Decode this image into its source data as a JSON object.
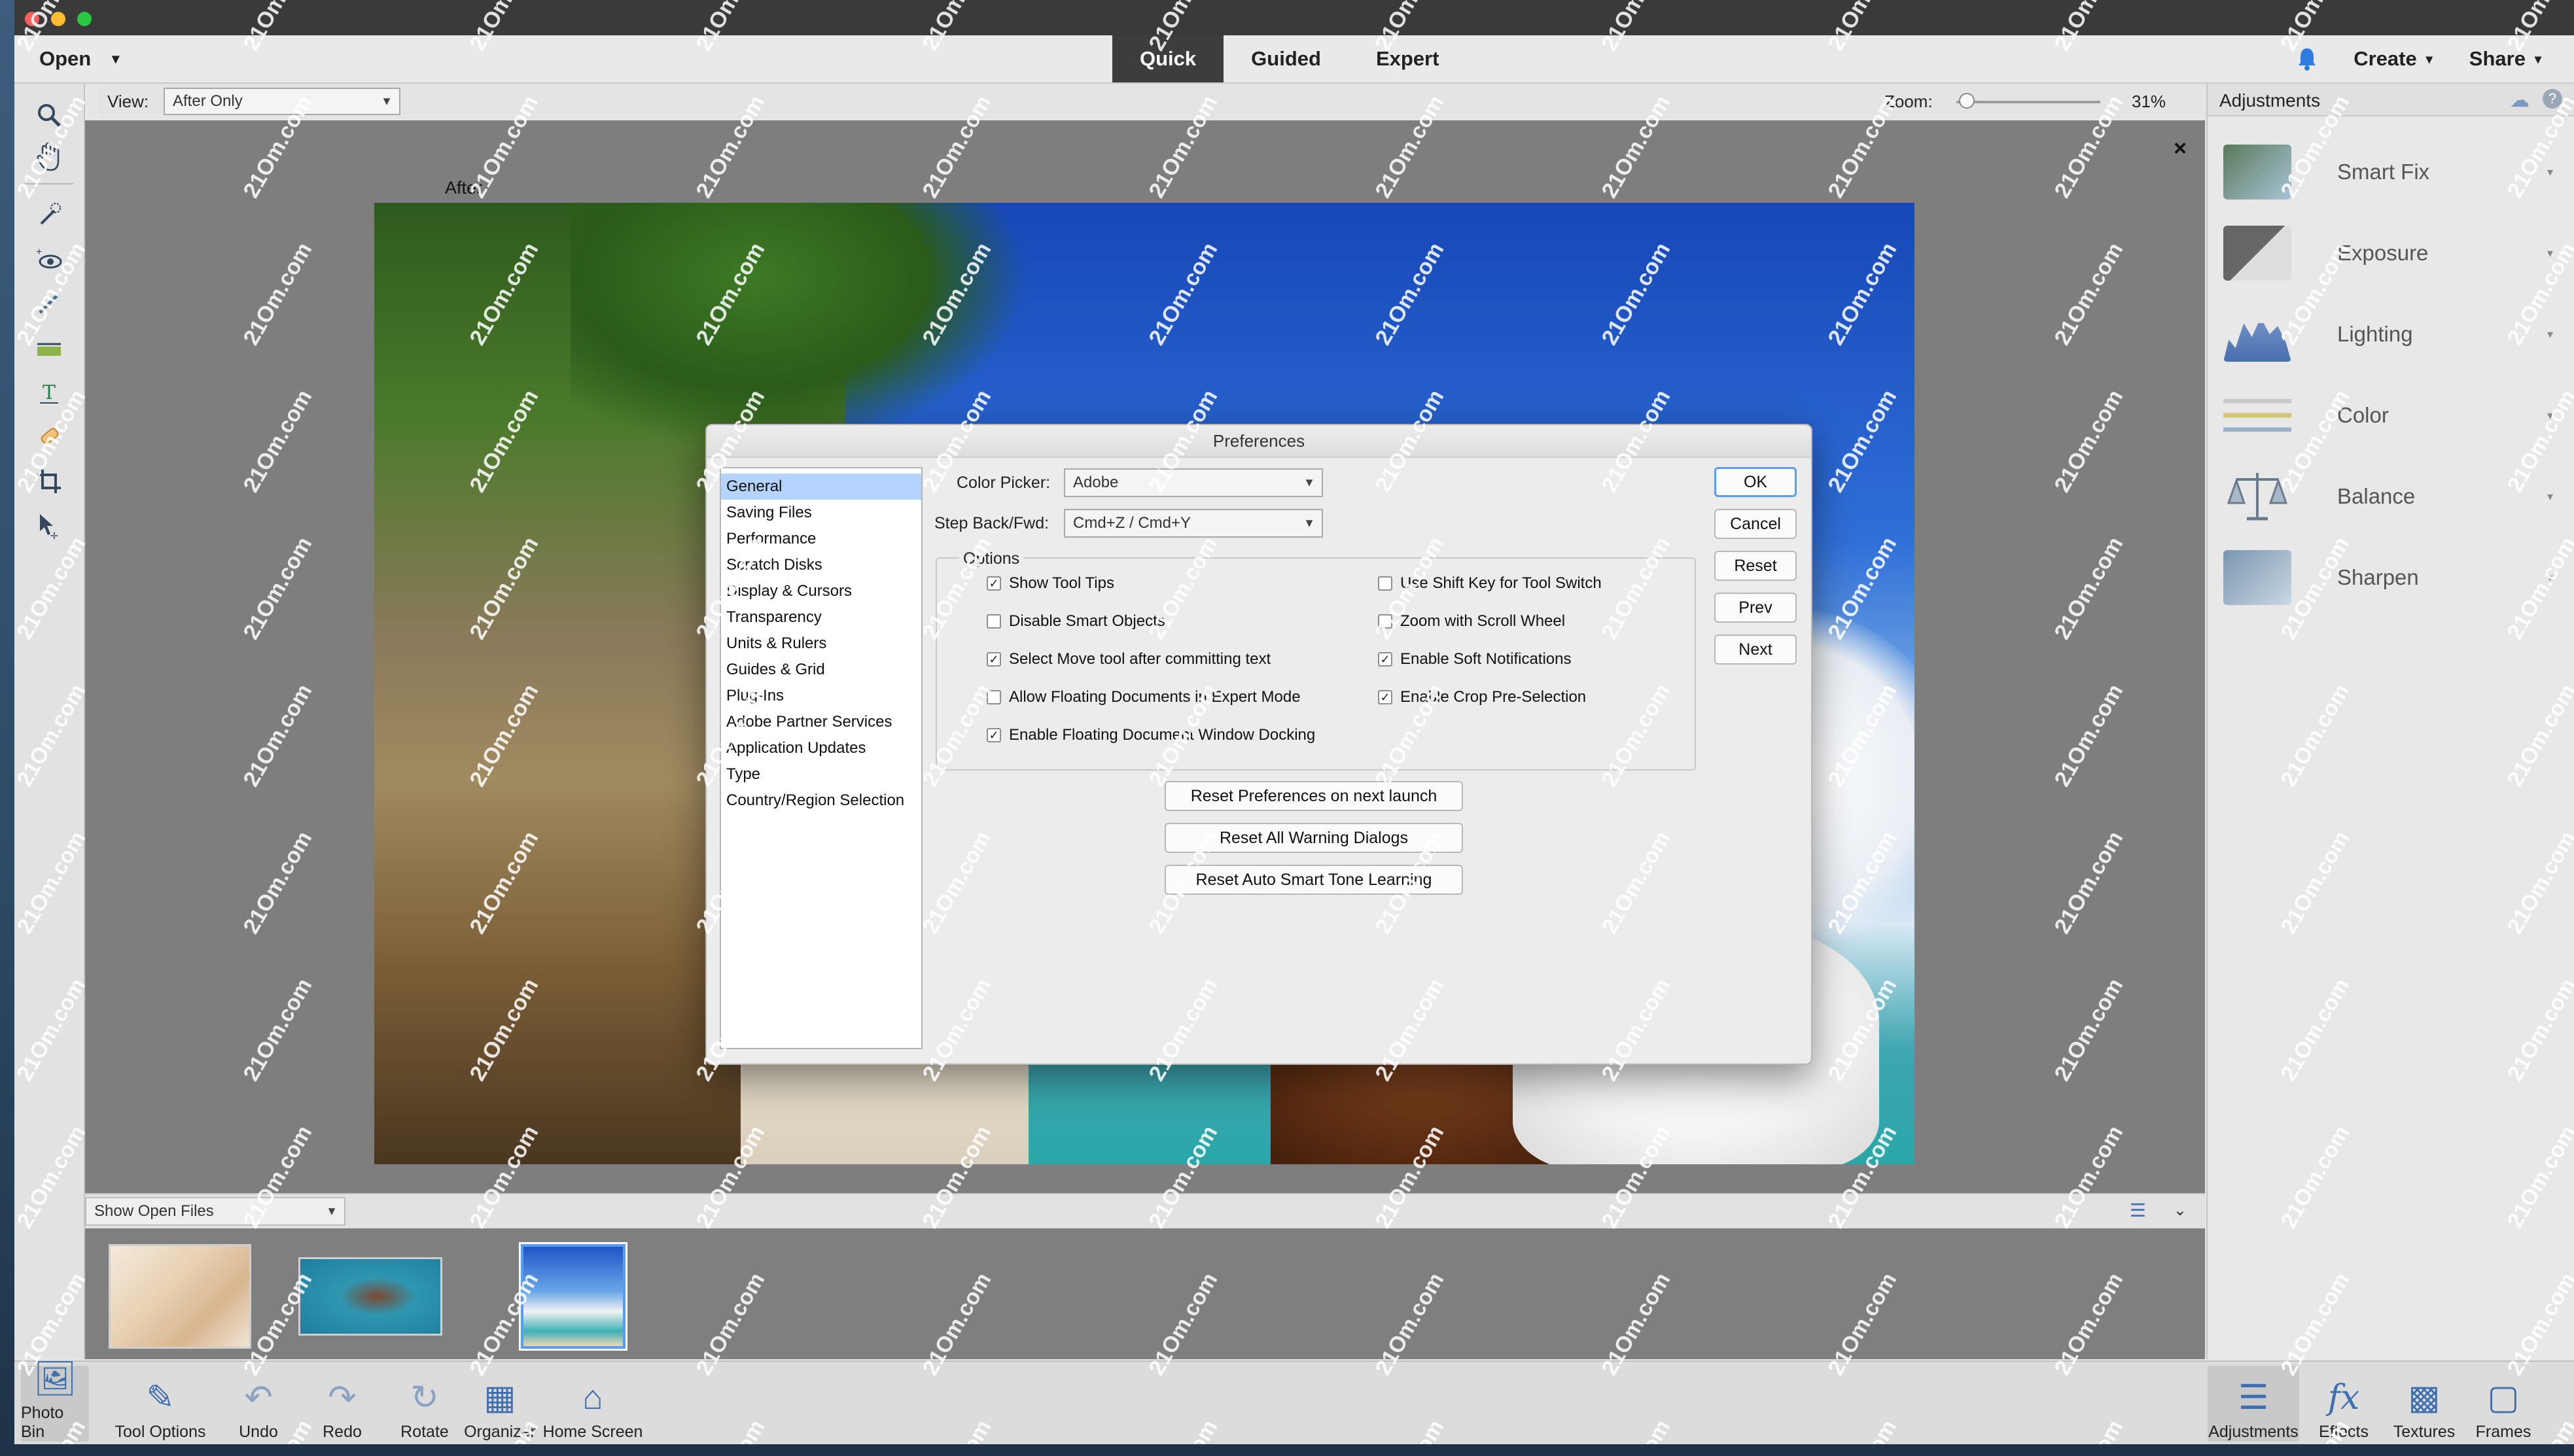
{
  "topbar": {
    "open_label": "Open",
    "open_arrow": "▾",
    "modes": [
      "Quick",
      "Guided",
      "Expert"
    ],
    "create_label": "Create",
    "share_label": "Share",
    "arrow": "▾"
  },
  "viewrow": {
    "view_label": "View:",
    "view_value": "After Only",
    "zoom_label": "Zoom:",
    "zoom_value": "31%",
    "zoom_level": 0.02
  },
  "canvas": {
    "after_label": "After",
    "close_glyph": "×"
  },
  "preferences": {
    "title": "Preferences",
    "categories": [
      "General",
      "Saving Files",
      "Performance",
      "Scratch Disks",
      "Display & Cursors",
      "Transparency",
      "Units & Rulers",
      "Guides & Grid",
      "Plug-Ins",
      "Adobe Partner Services",
      "Application Updates",
      "Type",
      "Country/Region Selection"
    ],
    "selected_category": "General",
    "color_picker_label": "Color Picker:",
    "color_picker_value": "Adobe",
    "step_label": "Step Back/Fwd:",
    "step_value": "Cmd+Z / Cmd+Y",
    "options_title": "Options",
    "options": [
      {
        "label": "Show Tool Tips",
        "checked": true
      },
      {
        "label": "Disable Smart Objects",
        "checked": false
      },
      {
        "label": "Select Move tool after committing text",
        "checked": true
      },
      {
        "label": "Allow Floating Documents in Expert Mode",
        "checked": false
      },
      {
        "label": "Enable Floating Document Window Docking",
        "checked": true
      },
      {
        "label": "Use Shift Key for Tool Switch",
        "checked": false
      },
      {
        "label": "Zoom with Scroll Wheel",
        "checked": false
      },
      {
        "label": "Enable Soft Notifications",
        "checked": true
      },
      {
        "label": "Enable Crop Pre-Selection",
        "checked": true
      }
    ],
    "buttons": {
      "ok": "OK",
      "cancel": "Cancel",
      "reset": "Reset",
      "prev": "Prev",
      "next": "Next"
    },
    "reset_prefs": "Reset Preferences on next launch",
    "reset_warnings": "Reset All Warning Dialogs",
    "reset_smart_tone": "Reset Auto Smart Tone Learning"
  },
  "bin": {
    "show_label": "Show Open Files"
  },
  "adjustments": {
    "title": "Adjustments",
    "items": [
      {
        "label": "Smart Fix",
        "icon": "smart-fix-icon"
      },
      {
        "label": "Exposure",
        "icon": "exposure-icon"
      },
      {
        "label": "Lighting",
        "icon": "lighting-icon"
      },
      {
        "label": "Color",
        "icon": "color-icon"
      },
      {
        "label": "Balance",
        "icon": "balance-icon"
      },
      {
        "label": "Sharpen",
        "icon": "sharpen-icon"
      }
    ]
  },
  "bottombar": {
    "left": [
      {
        "label": "Photo Bin",
        "icon": "photo-bin-icon"
      },
      {
        "label": "Tool Options",
        "icon": "tool-options-icon"
      },
      {
        "label": "Undo",
        "icon": "undo-icon"
      },
      {
        "label": "Redo",
        "icon": "redo-icon"
      },
      {
        "label": "Rotate",
        "icon": "rotate-icon"
      },
      {
        "label": "Organizer",
        "icon": "organizer-icon"
      },
      {
        "label": "Home Screen",
        "icon": "home-screen-icon"
      }
    ],
    "right": [
      {
        "label": "Adjustments",
        "icon": "adjustments-icon"
      },
      {
        "label": "Effects",
        "icon": "effects-icon"
      },
      {
        "label": "Textures",
        "icon": "textures-icon"
      },
      {
        "label": "Frames",
        "icon": "frames-icon"
      }
    ]
  },
  "watermark": "21Om.com",
  "colors": {
    "accent": "#5b9cf0",
    "active_mode_bg": "#3d3d3d",
    "selection": "#b4d4ff",
    "icon_blue": "#3e6fae"
  }
}
